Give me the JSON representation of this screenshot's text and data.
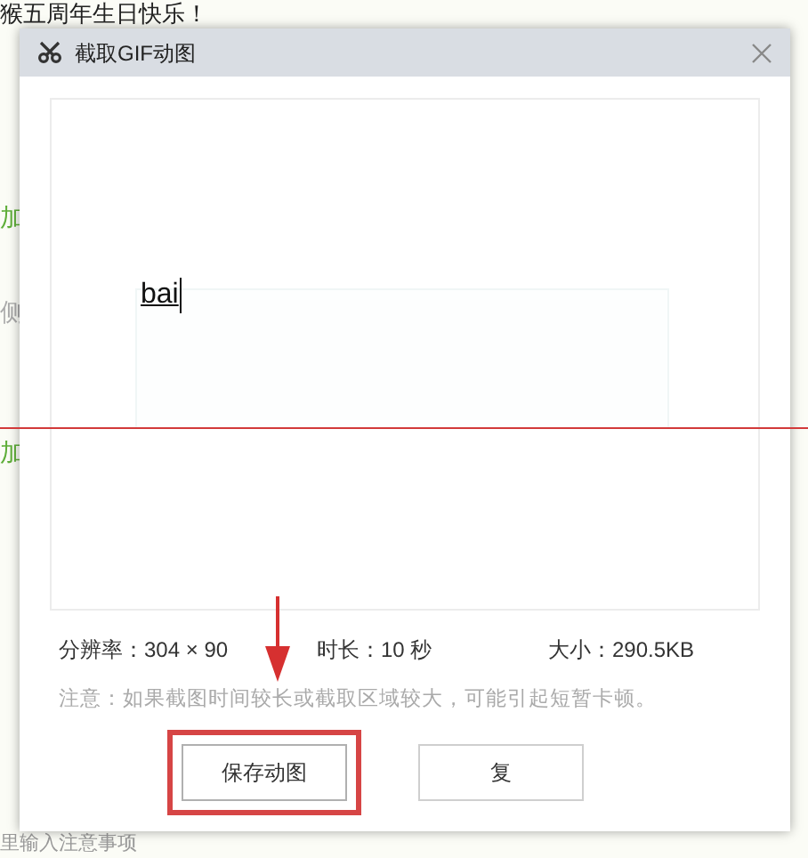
{
  "background_page": {
    "heading": "猴五周年生日快乐！",
    "side_labels": [
      {
        "text": "加",
        "kind": "green"
      },
      {
        "text": "侧",
        "kind": "grey"
      },
      {
        "text": "加",
        "kind": "green"
      }
    ],
    "footer_hint": "里输入注意事项"
  },
  "dialog": {
    "title": "截取GIF动图",
    "preview": {
      "typed_text": "bai"
    },
    "stats": [
      "分辨率：304 × 90",
      "时长：10 秒",
      "大小：290.5KB"
    ],
    "note": "注意：如果截图时间较长或截取区域较大，可能引起短暂卡顿。",
    "buttons": [
      {
        "label": "保存动图",
        "highlighted": true
      },
      {
        "label": "复",
        "highlighted": false
      }
    ]
  }
}
